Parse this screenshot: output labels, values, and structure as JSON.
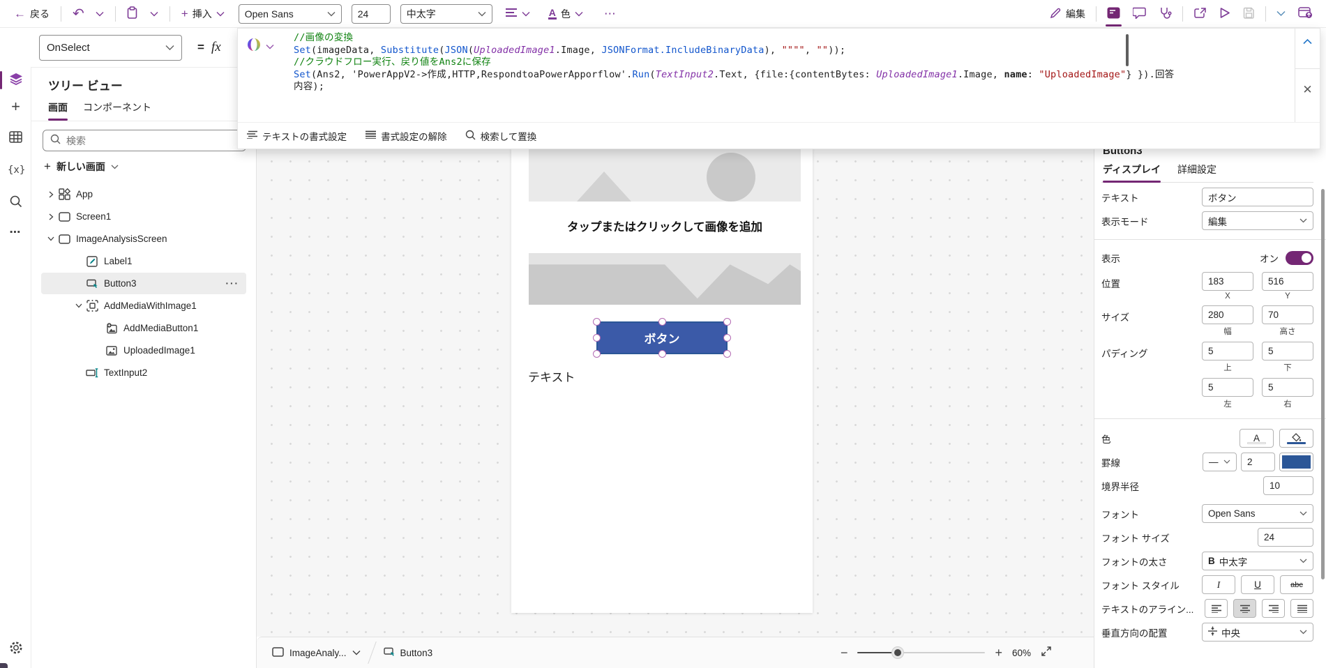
{
  "toolbar": {
    "back_label": "戻る",
    "insert_label": "挿入",
    "font_family_value": "Open Sans",
    "font_size_value": "24",
    "font_weight_value": "中太字",
    "color_label": "色",
    "edit_label": "編集"
  },
  "formula_bar": {
    "property_selector_value": "OnSelect",
    "equals_label": "=",
    "fx_label": "fx",
    "code_lines": [
      [
        {
          "t": "//画像の変換",
          "c": "comment"
        }
      ],
      [
        {
          "t": "Set",
          "c": "fn"
        },
        {
          "t": "(imageData, ",
          "c": "plain"
        },
        {
          "t": "Substitute",
          "c": "fn"
        },
        {
          "t": "(",
          "c": "plain"
        },
        {
          "t": "JSON",
          "c": "fn"
        },
        {
          "t": "(",
          "c": "plain"
        },
        {
          "t": "UploadedImage1",
          "c": "ctrl"
        },
        {
          "t": ".Image, ",
          "c": "plain"
        },
        {
          "t": "JSONFormat.IncludeBinaryData",
          "c": "fn"
        },
        {
          "t": "), ",
          "c": "plain"
        },
        {
          "t": "\"\"\"\"",
          "c": "str"
        },
        {
          "t": ", ",
          "c": "plain"
        },
        {
          "t": "\"\"",
          "c": "str"
        },
        {
          "t": "));",
          "c": "plain"
        }
      ],
      [
        {
          "t": "//クラウドフロー実行、戻り値をAns2に保存",
          "c": "comment"
        }
      ],
      [
        {
          "t": "Set",
          "c": "fn"
        },
        {
          "t": "(Ans2, 'PowerAppV2-&gt;作成,HTTP,RespondtoaPowerApporflow'.",
          "c": "plain",
          "raw": "(Ans2, 'PowerAppV2->作成,HTTP,RespondtoaPowerApporflow'.",
          "note": "raw holds literal text"
        },
        {
          "t": "Run",
          "c": "fn"
        },
        {
          "t": "(",
          "c": "plain"
        },
        {
          "t": "TextInput2",
          "c": "ctrl"
        },
        {
          "t": ".Text, {file:{contentBytes: ",
          "c": "plain"
        },
        {
          "t": "UploadedImage1",
          "c": "ctrl"
        },
        {
          "t": ".Image, ",
          "c": "plain"
        },
        {
          "t": "name",
          "c": "bold"
        },
        {
          "t": ": ",
          "c": "plain"
        },
        {
          "t": "\"UploadedImage\"",
          "c": "str"
        },
        {
          "t": "} }).回答",
          "c": "plain"
        }
      ],
      [
        {
          "t": "内容);",
          "c": "plain"
        }
      ]
    ],
    "footer_actions": [
      {
        "label": "テキストの書式設定",
        "icon": "format-text"
      },
      {
        "label": "書式設定の解除",
        "icon": "clear-format"
      },
      {
        "label": "検索して置換",
        "icon": "search"
      }
    ]
  },
  "sidebar": {
    "title": "ツリー ビュー",
    "tabs": [
      {
        "label": "画面",
        "active": true
      },
      {
        "label": "コンポーネント",
        "active": false
      }
    ],
    "search_placeholder": "検索",
    "new_screen_label": "新しい画面",
    "tree": [
      {
        "label": "App",
        "icon": "app",
        "indent": 0,
        "chevron": "collapsed"
      },
      {
        "label": "Screen1",
        "icon": "screen",
        "indent": 0,
        "chevron": "collapsed"
      },
      {
        "label": "ImageAnalysisScreen",
        "icon": "screen",
        "indent": 0,
        "chevron": "expanded"
      },
      {
        "label": "Label1",
        "icon": "label",
        "indent": 1
      },
      {
        "label": "Button3",
        "icon": "button",
        "indent": 1,
        "selected": true,
        "ellipsis": true
      },
      {
        "label": "AddMediaWithImage1",
        "icon": "group",
        "indent": 1,
        "chevron": "expanded"
      },
      {
        "label": "AddMediaButton1",
        "icon": "addmedia",
        "indent": 2
      },
      {
        "label": "UploadedImage1",
        "icon": "image",
        "indent": 2
      },
      {
        "label": "TextInput2",
        "icon": "textinput",
        "indent": 1
      }
    ]
  },
  "canvas": {
    "placeholder_text": "タップまたはクリックして画像を追加",
    "button_label": "ボタン",
    "button_color": "#3b5aa8",
    "button_border_color": "#2b5697",
    "text_label": "テキスト"
  },
  "properties_panel": {
    "title": "Button3",
    "tabs": [
      {
        "label": "ディスプレイ",
        "active": true
      },
      {
        "label": "詳細設定",
        "active": false
      }
    ],
    "text": {
      "label": "テキスト",
      "value": "ボタン"
    },
    "display_mode": {
      "label": "表示モード",
      "value": "編集"
    },
    "visible": {
      "label": "表示",
      "state_label": "オン"
    },
    "position": {
      "label": "位置",
      "x": "183",
      "y": "516",
      "x_label": "X",
      "y_label": "Y"
    },
    "size": {
      "label": "サイズ",
      "w": "280",
      "h": "70",
      "w_label": "幅",
      "h_label": "高さ"
    },
    "padding": {
      "label": "パディング",
      "top": "5",
      "bottom": "5",
      "left": "5",
      "right": "5",
      "top_label": "上",
      "bottom_label": "下",
      "left_label": "左",
      "right_label": "右"
    },
    "color": {
      "label": "色",
      "a_label": "A"
    },
    "border": {
      "label": "罫線",
      "width": "2",
      "swatch_color": "#2b5697"
    },
    "border_radius": {
      "label": "境界半径",
      "value": "10"
    },
    "font": {
      "label": "フォント",
      "value": "Open Sans"
    },
    "font_size": {
      "label": "フォント サイズ",
      "value": "24"
    },
    "font_weight": {
      "label": "フォントの太さ",
      "b_label": "B",
      "value": "中太字"
    },
    "font_style": {
      "label": "フォント スタイル",
      "italic_label": "I",
      "underline_label": "U",
      "strike_label": "abc"
    },
    "text_align": {
      "label": "テキストのアライン..."
    },
    "vertical_align": {
      "label": "垂直方向の配置",
      "value": "中央"
    }
  },
  "status_bar": {
    "screen_selector_value": "ImageAnaly...",
    "breadcrumb_control": "Button3",
    "zoom_value": "60%"
  }
}
